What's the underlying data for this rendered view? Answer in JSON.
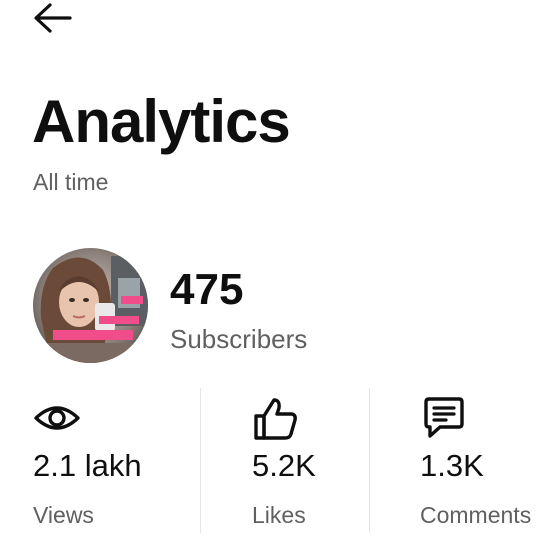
{
  "header": {
    "back_icon": "arrow-left-icon",
    "title": "Analytics",
    "subtitle": "All time"
  },
  "channel": {
    "avatar_icon": "channel-avatar",
    "subscriber_count": "475",
    "subscriber_label": "Subscribers"
  },
  "stats": [
    {
      "icon": "eye-icon",
      "value": "2.1 lakh",
      "label": "Views"
    },
    {
      "icon": "thumbs-up-icon",
      "value": "5.2K",
      "label": "Likes"
    },
    {
      "icon": "comment-icon",
      "value": "1.3K",
      "label": "Comments"
    }
  ],
  "colors": {
    "primary_text": "#0f0f0f",
    "secondary_text": "#606060",
    "divider": "#e5e5e5"
  }
}
